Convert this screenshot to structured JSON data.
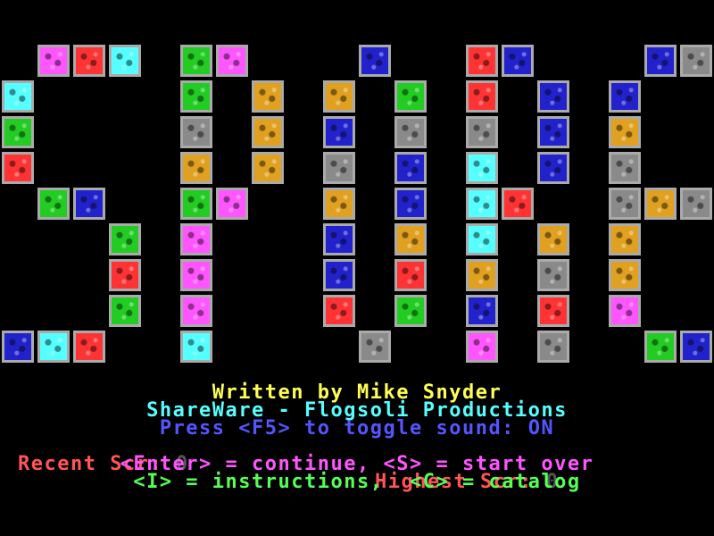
{
  "colors": {
    "background": "#000000",
    "tile_border": "#aaaaaa",
    "magenta": "#ff55ff",
    "red": "#ff3333",
    "cyan": "#55ffff",
    "green": "#22cc22",
    "blue": "#2222cc",
    "gray": "#8a8a8a",
    "yellow": "#e0a020"
  },
  "board": {
    "tiles": [
      {
        "col": 1,
        "row": 0,
        "color": "magenta"
      },
      {
        "col": 2,
        "row": 0,
        "color": "red"
      },
      {
        "col": 3,
        "row": 0,
        "color": "cyan"
      },
      {
        "col": 5,
        "row": 0,
        "color": "green"
      },
      {
        "col": 6,
        "row": 0,
        "color": "magenta"
      },
      {
        "col": 10,
        "row": 0,
        "color": "blue"
      },
      {
        "col": 13,
        "row": 0,
        "color": "red"
      },
      {
        "col": 14,
        "row": 0,
        "color": "blue"
      },
      {
        "col": 18,
        "row": 0,
        "color": "blue"
      },
      {
        "col": 19,
        "row": 0,
        "color": "gray"
      },
      {
        "col": 0,
        "row": 1,
        "color": "cyan"
      },
      {
        "col": 5,
        "row": 1,
        "color": "green"
      },
      {
        "col": 7,
        "row": 1,
        "color": "yellow"
      },
      {
        "col": 9,
        "row": 1,
        "color": "yellow"
      },
      {
        "col": 11,
        "row": 1,
        "color": "green"
      },
      {
        "col": 13,
        "row": 1,
        "color": "red"
      },
      {
        "col": 15,
        "row": 1,
        "color": "blue"
      },
      {
        "col": 17,
        "row": 1,
        "color": "blue"
      },
      {
        "col": 0,
        "row": 2,
        "color": "green"
      },
      {
        "col": 5,
        "row": 2,
        "color": "gray"
      },
      {
        "col": 7,
        "row": 2,
        "color": "yellow"
      },
      {
        "col": 9,
        "row": 2,
        "color": "blue"
      },
      {
        "col": 11,
        "row": 2,
        "color": "gray"
      },
      {
        "col": 13,
        "row": 2,
        "color": "gray"
      },
      {
        "col": 15,
        "row": 2,
        "color": "blue"
      },
      {
        "col": 17,
        "row": 2,
        "color": "yellow"
      },
      {
        "col": 0,
        "row": 3,
        "color": "red"
      },
      {
        "col": 5,
        "row": 3,
        "color": "yellow"
      },
      {
        "col": 7,
        "row": 3,
        "color": "yellow"
      },
      {
        "col": 9,
        "row": 3,
        "color": "gray"
      },
      {
        "col": 11,
        "row": 3,
        "color": "blue"
      },
      {
        "col": 13,
        "row": 3,
        "color": "cyan"
      },
      {
        "col": 15,
        "row": 3,
        "color": "blue"
      },
      {
        "col": 17,
        "row": 3,
        "color": "gray"
      },
      {
        "col": 1,
        "row": 4,
        "color": "green"
      },
      {
        "col": 2,
        "row": 4,
        "color": "blue"
      },
      {
        "col": 5,
        "row": 4,
        "color": "green"
      },
      {
        "col": 6,
        "row": 4,
        "color": "magenta"
      },
      {
        "col": 9,
        "row": 4,
        "color": "yellow"
      },
      {
        "col": 11,
        "row": 4,
        "color": "blue"
      },
      {
        "col": 13,
        "row": 4,
        "color": "cyan"
      },
      {
        "col": 14,
        "row": 4,
        "color": "red"
      },
      {
        "col": 17,
        "row": 4,
        "color": "gray"
      },
      {
        "col": 18,
        "row": 4,
        "color": "yellow"
      },
      {
        "col": 19,
        "row": 4,
        "color": "gray"
      },
      {
        "col": 3,
        "row": 5,
        "color": "green"
      },
      {
        "col": 5,
        "row": 5,
        "color": "magenta"
      },
      {
        "col": 9,
        "row": 5,
        "color": "blue"
      },
      {
        "col": 11,
        "row": 5,
        "color": "yellow"
      },
      {
        "col": 13,
        "row": 5,
        "color": "cyan"
      },
      {
        "col": 15,
        "row": 5,
        "color": "yellow"
      },
      {
        "col": 17,
        "row": 5,
        "color": "yellow"
      },
      {
        "col": 3,
        "row": 6,
        "color": "red"
      },
      {
        "col": 5,
        "row": 6,
        "color": "magenta"
      },
      {
        "col": 9,
        "row": 6,
        "color": "blue"
      },
      {
        "col": 11,
        "row": 6,
        "color": "red"
      },
      {
        "col": 13,
        "row": 6,
        "color": "yellow"
      },
      {
        "col": 15,
        "row": 6,
        "color": "gray"
      },
      {
        "col": 17,
        "row": 6,
        "color": "yellow"
      },
      {
        "col": 3,
        "row": 7,
        "color": "green"
      },
      {
        "col": 5,
        "row": 7,
        "color": "magenta"
      },
      {
        "col": 9,
        "row": 7,
        "color": "red"
      },
      {
        "col": 11,
        "row": 7,
        "color": "green"
      },
      {
        "col": 13,
        "row": 7,
        "color": "blue"
      },
      {
        "col": 15,
        "row": 7,
        "color": "red"
      },
      {
        "col": 17,
        "row": 7,
        "color": "magenta"
      },
      {
        "col": 0,
        "row": 8,
        "color": "blue"
      },
      {
        "col": 1,
        "row": 8,
        "color": "cyan"
      },
      {
        "col": 2,
        "row": 8,
        "color": "red"
      },
      {
        "col": 5,
        "row": 8,
        "color": "cyan"
      },
      {
        "col": 10,
        "row": 8,
        "color": "gray"
      },
      {
        "col": 13,
        "row": 8,
        "color": "magenta"
      },
      {
        "col": 15,
        "row": 8,
        "color": "gray"
      },
      {
        "col": 18,
        "row": 8,
        "color": "green"
      },
      {
        "col": 19,
        "row": 8,
        "color": "blue"
      }
    ]
  },
  "credits": {
    "author": "Written by Mike Snyder",
    "company": "ShareWare - Flogsoli Productions"
  },
  "sound": {
    "prefix": "Press <F5> to toggle sound: ",
    "state": "ON"
  },
  "scores": {
    "recent_label": "Recent Scr: ",
    "recent_value": "0",
    "highest_label": "Highest Scr: ",
    "highest_value": "0"
  },
  "menu": {
    "enter_line": "<Enter> = continue, <S> = start over",
    "keys_line": "<I> = instructions,  <C> = catalog"
  }
}
